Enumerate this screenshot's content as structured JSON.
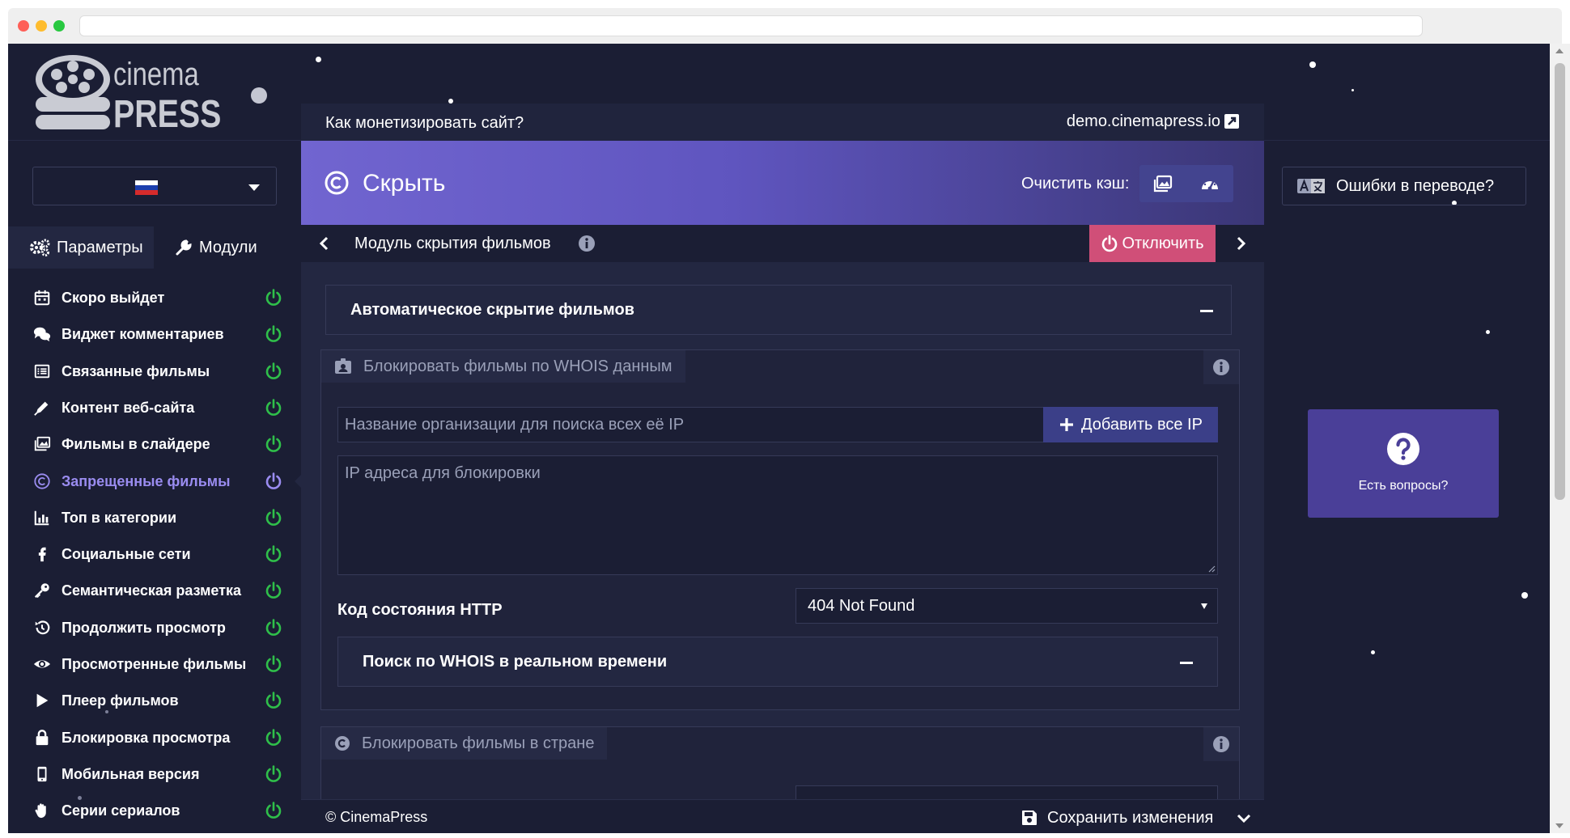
{
  "logo": {
    "line1": "cinema",
    "line2": "PRESS"
  },
  "sidebar": {
    "tabs": [
      {
        "label": "Параметры"
      },
      {
        "label": "Модули"
      }
    ],
    "items": [
      {
        "label": "Скоро выйдет",
        "icon": "calendar-icon",
        "status": "on"
      },
      {
        "label": "Виджет комментариев",
        "icon": "comments-icon",
        "status": "on"
      },
      {
        "label": "Связанные фильмы",
        "icon": "list-icon",
        "status": "on"
      },
      {
        "label": "Контент веб-сайта",
        "icon": "pen-icon",
        "status": "on"
      },
      {
        "label": "Фильмы в слайдере",
        "icon": "images-icon",
        "status": "on"
      },
      {
        "label": "Запрещенные фильмы",
        "icon": "copyright-icon",
        "status": "active"
      },
      {
        "label": "Топ в категории",
        "icon": "chart-icon",
        "status": "on"
      },
      {
        "label": "Социальные сети",
        "icon": "facebook-icon",
        "status": "on"
      },
      {
        "label": "Семантическая разметка",
        "icon": "key-icon",
        "status": "on"
      },
      {
        "label": "Продолжить просмотр",
        "icon": "history-icon",
        "status": "on"
      },
      {
        "label": "Просмотренные фильмы",
        "icon": "eye-icon",
        "status": "on"
      },
      {
        "label": "Плеер фильмов",
        "icon": "play-icon",
        "status": "on"
      },
      {
        "label": "Блокировка просмотра",
        "icon": "lock-icon",
        "status": "on"
      },
      {
        "label": "Мобильная версия",
        "icon": "mobile-icon",
        "status": "on"
      },
      {
        "label": "Серии сериалов",
        "icon": "hand-icon",
        "status": "on"
      }
    ]
  },
  "topbar": {
    "monetize": "Как монетизировать сайт?",
    "domain": "demo.cinemapress.io"
  },
  "hero": {
    "title": "Скрыть",
    "cache_label": "Очистить кэш:"
  },
  "module_bar": {
    "title": "Модуль скрытия фильмов",
    "disable_label": "Отключить"
  },
  "sections": {
    "auto_hide": {
      "title": "Автоматическое скрытие фильмов"
    },
    "whois": {
      "legend": "Блокировать фильмы по WHOIS данным",
      "org_placeholder": "Название организации для поиска всех её IP",
      "add_button": "Добавить все IP",
      "ip_placeholder": "IP адреса для блокировки",
      "http_label": "Код состояния HTTP",
      "http_value": "404 Not Found",
      "realtime_title": "Поиск по WHOIS в реальном времени"
    },
    "country": {
      "legend": "Блокировать фильмы в стране"
    }
  },
  "footer": {
    "copyright": "© CinemaPress",
    "save_label": "Сохранить изменения"
  },
  "right": {
    "translate_label": "Ошибки в переводе?",
    "questions_label": "Есть вопросы?"
  },
  "colors": {
    "background": "#1b1e34",
    "panel": "#232741",
    "accent": "#6c5fcf",
    "danger": "#d04f78",
    "power_on": "#2fbf4a",
    "power_active": "#9a8cf0"
  }
}
